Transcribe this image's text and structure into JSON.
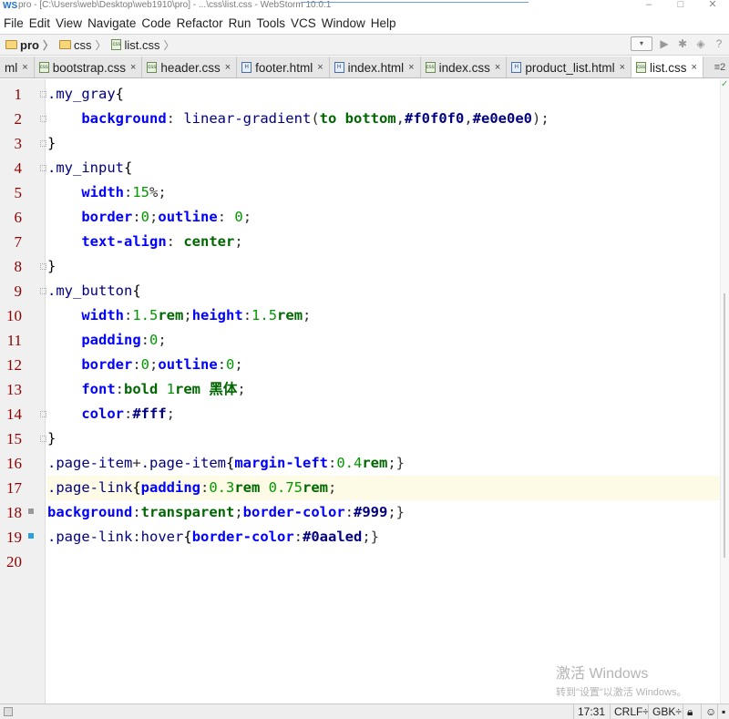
{
  "window": {
    "title": "pro - [C:\\Users\\web\\Desktop\\web1910\\pro] - ...\\css\\list.css - WebStorm 10.0.1",
    "app_icon": "WS"
  },
  "menu": [
    "File",
    "Edit",
    "View",
    "Navigate",
    "Code",
    "Refactor",
    "Run",
    "Tools",
    "VCS",
    "Window",
    "Help"
  ],
  "breadcrumb": {
    "project": "pro",
    "folder": "css",
    "file": "list.css"
  },
  "tabs": [
    {
      "label": "ml",
      "kind": "partial"
    },
    {
      "label": "bootstrap.css",
      "kind": "css"
    },
    {
      "label": "header.css",
      "kind": "css"
    },
    {
      "label": "footer.html",
      "kind": "html"
    },
    {
      "label": "index.html",
      "kind": "html"
    },
    {
      "label": "index.css",
      "kind": "css"
    },
    {
      "label": "product_list.html",
      "kind": "html"
    },
    {
      "label": "list.css",
      "kind": "css",
      "active": true
    }
  ],
  "tab_close": "×",
  "tab_overflow": "≡2",
  "line_numbers": [
    "1",
    "2",
    "3",
    "4",
    "5",
    "6",
    "7",
    "8",
    "9",
    "10",
    "11",
    "12",
    "13",
    "14",
    "15",
    "16",
    "17",
    "18",
    "19",
    "20"
  ],
  "code": [
    [
      {
        "t": ".my_gray",
        "c": "sel"
      },
      {
        "t": "{",
        "c": "br"
      }
    ],
    [
      {
        "t": "    "
      },
      {
        "t": "background",
        "c": "prop"
      },
      {
        "t": ": ",
        "c": "punc"
      },
      {
        "t": "linear-gradient",
        "c": "fn"
      },
      {
        "t": "(",
        "c": "punc"
      },
      {
        "t": "to bottom",
        "c": "val"
      },
      {
        "t": ",",
        "c": "punc"
      },
      {
        "t": "#f0f0f0",
        "c": "hex"
      },
      {
        "t": ",",
        "c": "punc"
      },
      {
        "t": "#e0e0e0",
        "c": "hex"
      },
      {
        "t": ");",
        "c": "punc"
      }
    ],
    [
      {
        "t": "}",
        "c": "br"
      }
    ],
    [
      {
        "t": ".my_input",
        "c": "sel"
      },
      {
        "t": "{",
        "c": "br"
      }
    ],
    [
      {
        "t": "    "
      },
      {
        "t": "width",
        "c": "prop"
      },
      {
        "t": ":",
        "c": "punc"
      },
      {
        "t": "15",
        "c": "num"
      },
      {
        "t": "%;",
        "c": "punc"
      }
    ],
    [
      {
        "t": "    "
      },
      {
        "t": "border",
        "c": "prop"
      },
      {
        "t": ":",
        "c": "punc"
      },
      {
        "t": "0",
        "c": "num"
      },
      {
        "t": ";",
        "c": "punc"
      },
      {
        "t": "outline",
        "c": "prop"
      },
      {
        "t": ": ",
        "c": "punc"
      },
      {
        "t": "0",
        "c": "num"
      },
      {
        "t": ";",
        "c": "punc"
      }
    ],
    [
      {
        "t": "    "
      },
      {
        "t": "text-align",
        "c": "prop"
      },
      {
        "t": ": ",
        "c": "punc"
      },
      {
        "t": "center",
        "c": "val"
      },
      {
        "t": ";",
        "c": "punc"
      }
    ],
    [
      {
        "t": "}",
        "c": "br"
      }
    ],
    [
      {
        "t": ".my_button",
        "c": "sel"
      },
      {
        "t": "{",
        "c": "br"
      }
    ],
    [
      {
        "t": "    "
      },
      {
        "t": "width",
        "c": "prop"
      },
      {
        "t": ":",
        "c": "punc"
      },
      {
        "t": "1.5",
        "c": "num"
      },
      {
        "t": "rem",
        "c": "val"
      },
      {
        "t": ";",
        "c": "punc"
      },
      {
        "t": "height",
        "c": "prop"
      },
      {
        "t": ":",
        "c": "punc"
      },
      {
        "t": "1.5",
        "c": "num"
      },
      {
        "t": "rem",
        "c": "val"
      },
      {
        "t": ";",
        "c": "punc"
      }
    ],
    [
      {
        "t": "    "
      },
      {
        "t": "padding",
        "c": "prop"
      },
      {
        "t": ":",
        "c": "punc"
      },
      {
        "t": "0",
        "c": "num"
      },
      {
        "t": ";",
        "c": "punc"
      }
    ],
    [
      {
        "t": "    "
      },
      {
        "t": "border",
        "c": "prop"
      },
      {
        "t": ":",
        "c": "punc"
      },
      {
        "t": "0",
        "c": "num"
      },
      {
        "t": ";",
        "c": "punc"
      },
      {
        "t": "outline",
        "c": "prop"
      },
      {
        "t": ":",
        "c": "punc"
      },
      {
        "t": "0",
        "c": "num"
      },
      {
        "t": ";",
        "c": "punc"
      }
    ],
    [
      {
        "t": "    "
      },
      {
        "t": "font",
        "c": "prop"
      },
      {
        "t": ":",
        "c": "punc"
      },
      {
        "t": "bold ",
        "c": "val"
      },
      {
        "t": "1",
        "c": "num"
      },
      {
        "t": "rem ",
        "c": "val"
      },
      {
        "t": "黑体",
        "c": "val"
      },
      {
        "t": ";",
        "c": "punc"
      }
    ],
    [
      {
        "t": "    "
      },
      {
        "t": "color",
        "c": "prop"
      },
      {
        "t": ":",
        "c": "punc"
      },
      {
        "t": "#fff",
        "c": "hex"
      },
      {
        "t": ";",
        "c": "punc"
      }
    ],
    [
      {
        "t": "}",
        "c": "br"
      }
    ],
    [
      {
        "t": ".page-item",
        "c": "sel"
      },
      {
        "t": "+",
        "c": "punc"
      },
      {
        "t": ".page-item",
        "c": "sel"
      },
      {
        "t": "{",
        "c": "br"
      },
      {
        "t": "margin-left",
        "c": "prop"
      },
      {
        "t": ":",
        "c": "punc"
      },
      {
        "t": "0.4",
        "c": "num"
      },
      {
        "t": "rem",
        "c": "val"
      },
      {
        "t": ";}",
        "c": "punc"
      }
    ],
    [
      {
        "t": ".page-link",
        "c": "sel"
      },
      {
        "t": "{",
        "c": "br"
      },
      {
        "t": "padding",
        "c": "prop"
      },
      {
        "t": ":",
        "c": "punc"
      },
      {
        "t": "0.3",
        "c": "num"
      },
      {
        "t": "rem ",
        "c": "val"
      },
      {
        "t": "0.75",
        "c": "num"
      },
      {
        "t": "rem",
        "c": "val"
      },
      {
        "t": ";",
        "c": "punc"
      }
    ],
    [
      {
        "t": "background",
        "c": "prop"
      },
      {
        "t": ":",
        "c": "punc"
      },
      {
        "t": "transparent",
        "c": "val"
      },
      {
        "t": ";",
        "c": "punc"
      },
      {
        "t": "border-color",
        "c": "prop"
      },
      {
        "t": ":",
        "c": "punc"
      },
      {
        "t": "#999",
        "c": "hex"
      },
      {
        "t": ";}",
        "c": "punc"
      }
    ],
    [
      {
        "t": ".page-link",
        "c": "sel"
      },
      {
        "t": ":",
        "c": "punc"
      },
      {
        "t": "hover",
        "c": "sel"
      },
      {
        "t": "{",
        "c": "br"
      },
      {
        "t": "border-color",
        "c": "prop"
      },
      {
        "t": ":",
        "c": "punc"
      },
      {
        "t": "#0aaled",
        "c": "hex"
      },
      {
        "t": ";}",
        "c": "punc"
      }
    ],
    []
  ],
  "current_line": 17,
  "watermark": {
    "line1": "激活 Windows",
    "line2": "转到\"设置\"以激活 Windows。"
  },
  "status": {
    "position": "17:31",
    "line_sep": "CRLF÷",
    "encoding": "GBK÷"
  },
  "colors": {
    "line_number": "#8b0000",
    "selector": "#000080",
    "property": "#0000ff",
    "number": "#009900",
    "current_line_bg": "#fdfbe6"
  }
}
